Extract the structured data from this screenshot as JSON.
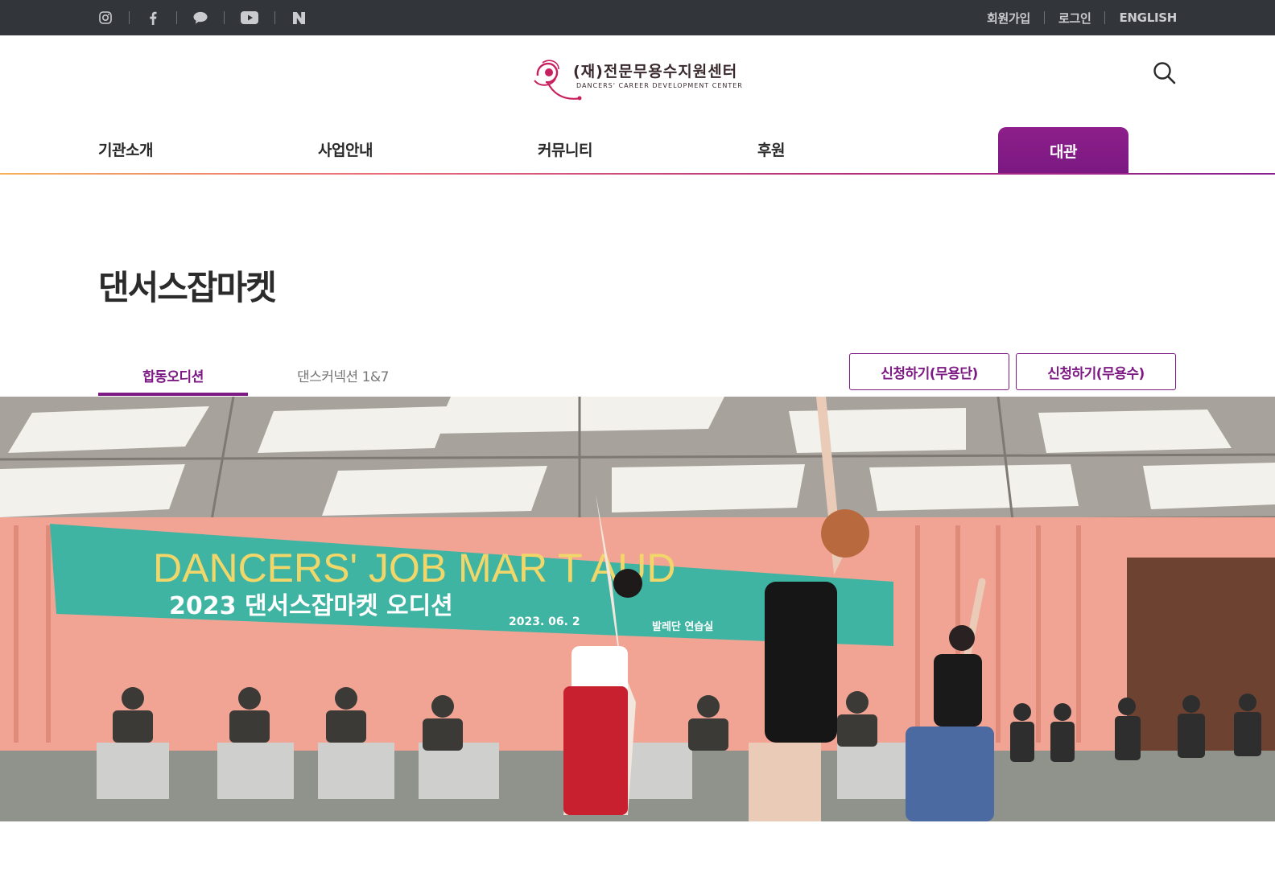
{
  "social_icons": [
    "instagram-icon",
    "facebook-icon",
    "talk-bubble-icon",
    "youtube-icon",
    "naver-icon"
  ],
  "utility": {
    "signup": "회원가입",
    "login": "로그인",
    "english": "ENGLISH"
  },
  "logo": {
    "korean": "(재)전문무용수지원센터",
    "english": "DANCERS' CAREER DEVELOPMENT CENTER"
  },
  "nav": {
    "items": [
      "기관소개",
      "사업안내",
      "커뮤니티",
      "후원"
    ],
    "active": "대관"
  },
  "page": {
    "title": "댄서스잡마켓"
  },
  "tabs": [
    "합동오디션",
    "댄스커넥션 1&7"
  ],
  "buttons": {
    "apply_company": "신청하기(무용단)",
    "apply_dancer": "신청하기(무용수)"
  },
  "hero": {
    "banner_en": "DANCERS' JOB MAR T AUD",
    "banner_kr": "2023 댄서스잡마켓 오디션",
    "banner_date": "2023. 06. 2",
    "banner_venue": "발레단 연습실"
  },
  "colors": {
    "topbar": "#32353a",
    "accent": "#7d1a84",
    "banner": "#3fb4a2",
    "curtain": "#f2a494"
  }
}
